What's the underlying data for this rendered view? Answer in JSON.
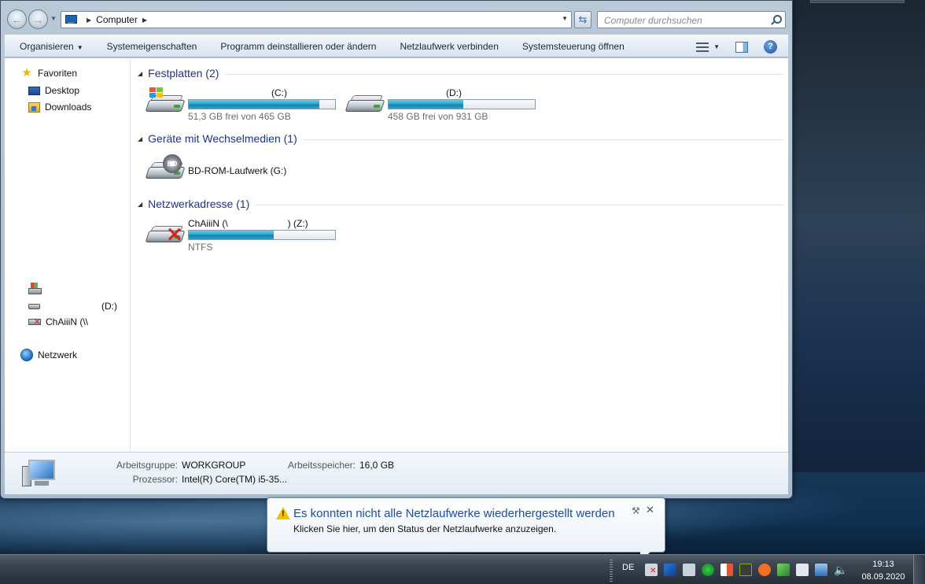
{
  "address": {
    "path": "Computer"
  },
  "search": {
    "placeholder": "Computer durchsuchen"
  },
  "toolbar": {
    "organize": "Organisieren",
    "system_properties": "Systemeigenschaften",
    "uninstall": "Programm deinstallieren oder ändern",
    "map_drive": "Netzlaufwerk verbinden",
    "control_panel": "Systemsteuerung öffnen"
  },
  "navpane": {
    "favorites": "Favoriten",
    "desktop": "Desktop",
    "downloads": "Downloads",
    "drive_d": "(D:)",
    "netdrive": "ChAiiiN (\\\\",
    "network": "Netzwerk"
  },
  "groups": {
    "hard_disks": "Festplatten (2)",
    "removable": "Geräte mit Wechselmedien (1)",
    "network_locations": "Netzwerkadresse (1)"
  },
  "drives": {
    "c": {
      "name": "(C:)",
      "free": "51,3 GB frei von 465 GB",
      "used_fraction": 0.89
    },
    "d": {
      "name": "(D:)",
      "free": "458 GB frei von 931 GB",
      "used_fraction": 0.51
    },
    "g": {
      "name": "BD-ROM-Laufwerk (G:)",
      "disc_label": "BD"
    },
    "z": {
      "name_prefix": "ChAiiiN (\\",
      "name_suffix": ") (Z:)",
      "fs": "NTFS",
      "used_fraction": 0.58
    }
  },
  "details": {
    "workgroup_label": "Arbeitsgruppe:",
    "workgroup": "WORKGROUP",
    "memory_label": "Arbeitsspeicher:",
    "memory": "16,0 GB",
    "processor_label": "Prozessor:",
    "processor": "Intel(R) Core(TM) i5-35..."
  },
  "balloon": {
    "title": "Es konnten nicht alle Netzlaufwerke wiederhergestellt werden",
    "text": "Klicken Sie hier, um den Status der Netzlaufwerke anzuzeigen."
  },
  "taskbar": {
    "language": "DE",
    "time": "19:13",
    "date": "08.09.2020"
  },
  "colors": {
    "group_title": "#1e3287",
    "balloon_title": "#1e4da0",
    "bar_fill": "#27a7cf"
  }
}
